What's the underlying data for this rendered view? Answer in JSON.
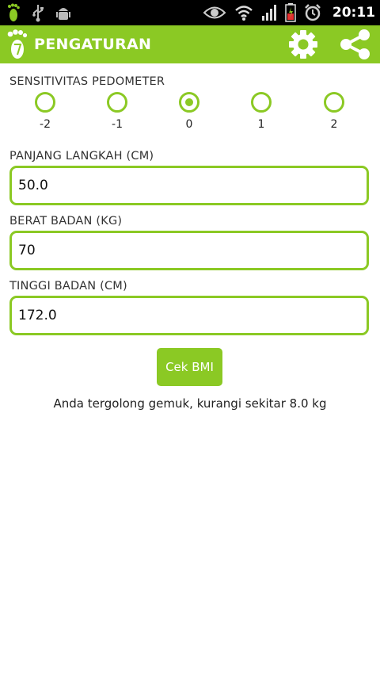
{
  "status_bar": {
    "time": "20:11",
    "left_icons": [
      "footprint-icon",
      "usb-icon",
      "android-debug-icon"
    ],
    "right_icons": [
      "eye-icon",
      "wifi-icon",
      "signal-icon",
      "battery-icon",
      "alarm-icon"
    ]
  },
  "action_bar": {
    "title": "PENGATURAN",
    "logo_icon": "footprint-icon",
    "actions": [
      "gear-icon",
      "share-icon"
    ],
    "color": "#8bc924"
  },
  "sensitivity": {
    "label": "SENSITIVITAS PEDOMETER",
    "options": [
      "-2",
      "-1",
      "0",
      "1",
      "2"
    ],
    "selected": "0"
  },
  "step_length": {
    "label": "PANJANG LANGKAH (CM)",
    "value": "50.0"
  },
  "weight": {
    "label": "BERAT BADAN (KG)",
    "value": "70"
  },
  "height": {
    "label": "TINGGI BADAN (CM)",
    "value": "172.0"
  },
  "bmi_button": {
    "label": "Cek BMI"
  },
  "result_text": "Anda tergolong gemuk, kurangi sekitar 8.0 kg",
  "colors": {
    "accent": "#8bc924",
    "statusbar": "#000000"
  }
}
